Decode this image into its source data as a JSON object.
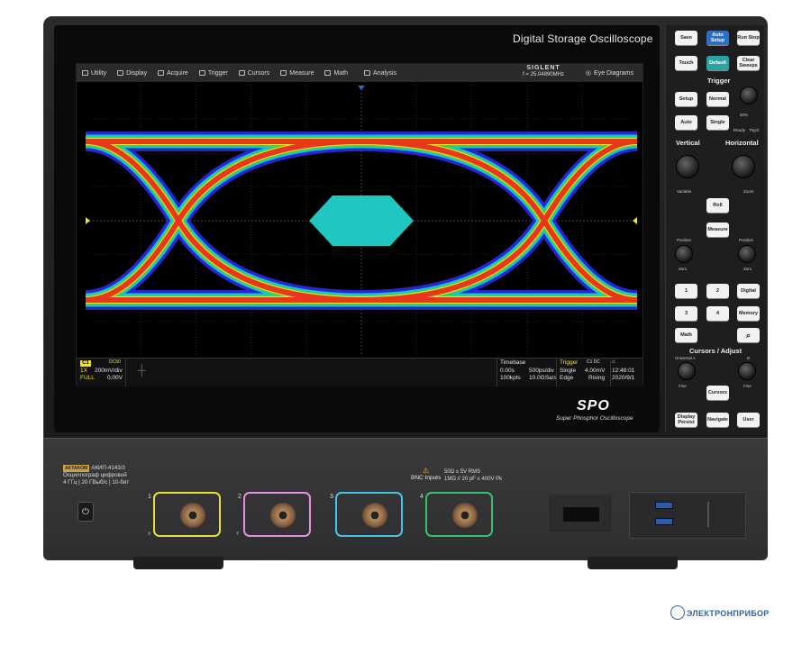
{
  "window": {
    "title": "Digital Storage Oscilloscope"
  },
  "menu": [
    {
      "label": "Utility",
      "icon": "utility-icon"
    },
    {
      "label": "Display",
      "icon": "display-icon"
    },
    {
      "label": "Acquire",
      "icon": "acquire-icon"
    },
    {
      "label": "Trigger",
      "icon": "trigger-icon"
    },
    {
      "label": "Cursors",
      "icon": "cursors-icon"
    },
    {
      "label": "Measure",
      "icon": "measure-icon"
    },
    {
      "label": "Math",
      "icon": "math-icon"
    },
    {
      "label": "Analysis",
      "icon": "analysis-icon"
    }
  ],
  "brand": {
    "name": "SIGLENT",
    "frequency": "f = 25.04890MHz"
  },
  "eye_diagrams": {
    "label": "Eye Diagrams",
    "icon": "eye-icon"
  },
  "eye_mask": {
    "color": "#1fc7c0",
    "shape": "hexagon"
  },
  "channel": {
    "tag": "C1",
    "coupling": "DC50",
    "probe": "1X",
    "scale": "200mV/div",
    "bandwidth": "FULL",
    "offset": "0.00V"
  },
  "timebase": {
    "label": "Timebase",
    "delay": "0.00s",
    "scale": "500ps/div",
    "points": "100kpts",
    "rate": "10.0GSa/s"
  },
  "trigger": {
    "label": "Trigger",
    "source": "C1 DC",
    "mode": "Single",
    "level": "4.00mV",
    "type": "Edge",
    "slope": "Rising"
  },
  "clock": {
    "time": "12:48:01",
    "date": "2020/9/1"
  },
  "panel": {
    "save": "Save",
    "auto_setup": "Auto Setup",
    "run_stop": "Run Stop",
    "touch": "Touch",
    "default": "Default",
    "clear_sweeps": "Clear Sweeps",
    "trigger_title": "Trigger",
    "setup": "Setup",
    "normal": "Normal",
    "auto": "Auto",
    "single": "Single",
    "level_pct": "50%",
    "ready": "Ready",
    "trigd": "Trig'd",
    "vertical_title": "Vertical",
    "horizontal_title": "Horizontal",
    "variable": "Variable",
    "zoom": "Zoom",
    "roll": "Roll",
    "measure": "Measure",
    "position_left": "Position",
    "position_right": "Position",
    "zero_left": "Zero",
    "zero_right": "Zero",
    "ch1": "1",
    "ch2": "2",
    "digital": "Digital",
    "ch3": "3",
    "ch4": "4",
    "memory": "Memory",
    "math": "Math",
    "search": "search-icon",
    "cursors_title": "Cursors / Adjust",
    "universal_a": "Universal A",
    "b": "B",
    "fine_left": "Fine",
    "fine_right": "Fine",
    "cursors": "Cursors",
    "display_persist": "Display Persist",
    "navigate": "Navigate",
    "user": "User"
  },
  "spo": {
    "logo": "SPO",
    "subtitle": "Super Phosphor Oscilloscope"
  },
  "front": {
    "badge_brand": "AKTAKOM",
    "model": "АКИП-4143/3",
    "desc1": "Осциллограф цифровой",
    "desc2": "4 ГГц | 20 ГВыб/с | 10-бит",
    "bnc_title": "BNC Inputs",
    "bnc_spec1": "50Ω ≤ 5V RMS",
    "bnc_spec2": "1MΩ // 20 pF ≤ 400V Pk",
    "channels": [
      "1",
      "2",
      "3",
      "4"
    ],
    "x_label": "X",
    "y_label": "Y",
    "colors": [
      "#e7dd3b",
      "#e68ee0",
      "#47c3e8",
      "#3bc06a"
    ]
  },
  "watermark": "ЭЛЕКТРОНПРИБОР"
}
